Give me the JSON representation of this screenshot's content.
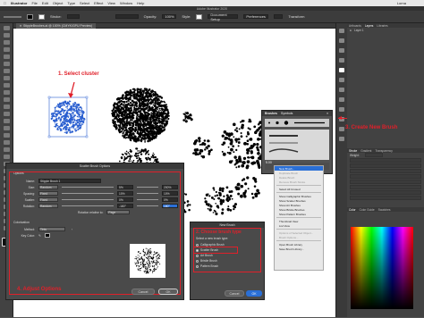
{
  "menubar": {
    "app": "Illustrator",
    "items": [
      "File",
      "Edit",
      "Object",
      "Type",
      "Select",
      "Effect",
      "View",
      "Window",
      "Help"
    ],
    "user": "Lorna"
  },
  "titlebar": {
    "title": "Adobe Illustrator 2020"
  },
  "controlbar": {
    "stroke_label": "Stroke:",
    "opacity_label": "Opacity:",
    "opacity_value": "100%",
    "style_label": "Style:",
    "doc_setup": "Document Setup",
    "preferences": "Preferences",
    "transform": "Transform"
  },
  "document": {
    "tab_label": "StippleBrushes.ai @ 100% (CMYK/GPU Preview)"
  },
  "annotations": {
    "step1": "1. Select cluster",
    "step2": "2. Choose brush type",
    "step3": "3. Create New Brush",
    "step4": "4. Adjust Options"
  },
  "colors": {
    "annotation_red": "#e0202a",
    "selection_blue": "#2a5fd0",
    "menu_highlight": "#2a6fd6"
  },
  "right_panels": {
    "top_tabs": [
      "Artboards",
      "Layers",
      "Libraries"
    ],
    "layer_name": "Layer 1",
    "stroke_tabs": [
      "Stroke",
      "Gradient",
      "Transparency"
    ],
    "weight_label": "Weight:",
    "color_tabs": [
      "Color",
      "Color Guide",
      "Swatches"
    ]
  },
  "brush_panel": {
    "tabs": [
      "Brushes",
      "Symbols"
    ],
    "size_value": "5.00"
  },
  "brush_menu": {
    "items": [
      {
        "label": "New Brush...",
        "state": "selected"
      },
      {
        "label": "Duplicate Brush",
        "state": "disabled"
      },
      {
        "label": "Delete Brush",
        "state": "disabled"
      },
      {
        "label": "Remove Brush Stroke",
        "state": "disabled"
      },
      {
        "label": "Select All Unused",
        "state": "normal"
      },
      {
        "label": "Show Calligraphic Brushes",
        "state": "checked"
      },
      {
        "label": "Show Scatter Brushes",
        "state": "checked"
      },
      {
        "label": "Show Art Brushes",
        "state": "checked"
      },
      {
        "label": "Show Bristle Brushes",
        "state": "checked"
      },
      {
        "label": "Show Pattern Brushes",
        "state": "checked"
      },
      {
        "label": "Thumbnail View",
        "state": "checked"
      },
      {
        "label": "List View",
        "state": "normal"
      },
      {
        "label": "Options of Selected Object...",
        "state": "disabled"
      },
      {
        "label": "Brush Options...",
        "state": "disabled"
      },
      {
        "label": "Open Brush Library",
        "state": "normal"
      },
      {
        "label": "Save Brush Library...",
        "state": "normal"
      }
    ]
  },
  "scatter_dialog": {
    "title": "Scatter Brush Options",
    "options_label": "Options",
    "name_label": "Name:",
    "name_value": "Stipple Brush 1",
    "rows": [
      {
        "label": "Size:",
        "mode": "Random",
        "min": "5%",
        "max": "200%"
      },
      {
        "label": "Spacing:",
        "mode": "Fixed",
        "min": "10%",
        "max": "10%"
      },
      {
        "label": "Scatter:",
        "mode": "Fixed",
        "min": "0%",
        "max": "0%"
      },
      {
        "label": "Rotation:",
        "mode": "Random",
        "min": "-180°",
        "max": "180°"
      }
    ],
    "rotation_relative_label": "Rotation relative to:",
    "rotation_relative_value": "Page",
    "colorization_label": "Colorization",
    "method_label": "Method:",
    "method_value": "Tints",
    "key_color_label": "Key Color:",
    "cancel": "Cancel",
    "ok": "OK"
  },
  "new_brush_dialog": {
    "title": "New Brush",
    "prompt": "Select a new brush type:",
    "types": [
      {
        "label": "Calligraphic Brush",
        "selected": false
      },
      {
        "label": "Scatter Brush",
        "selected": true
      },
      {
        "label": "Art Brush",
        "selected": false
      },
      {
        "label": "Bristle Brush",
        "selected": false
      },
      {
        "label": "Pattern Brush",
        "selected": false
      }
    ],
    "cancel": "Cancel",
    "ok": "OK"
  }
}
